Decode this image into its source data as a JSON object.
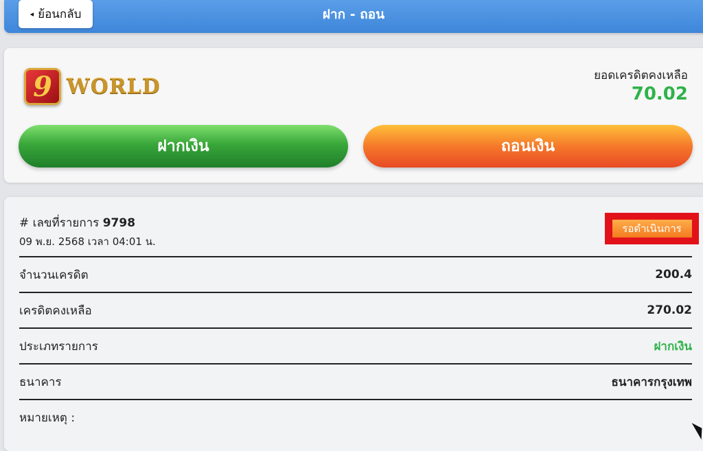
{
  "header": {
    "back_label": "ย้อนกลับ",
    "title": "ฝาก - ถอน"
  },
  "wallet": {
    "logo_text": "WORLD",
    "logo_letter": "9",
    "balance_label": "ยอดเครดิตคงเหลือ",
    "balance_value": "70.02",
    "deposit_label": "ฝากเงิน",
    "withdraw_label": "ถอนเงิน"
  },
  "transaction": {
    "id_prefix": "# เลขที่รายการ",
    "id_number": "9798",
    "datetime": "09 พ.ย. 2568 เวลา 04:01 น.",
    "status": "รอดำเนินการ",
    "rows": [
      {
        "label": "จำนวนเครดิต",
        "value": "200.4"
      },
      {
        "label": "เครดิตคงเหลือ",
        "value": "270.02"
      },
      {
        "label": "ประเภทรายการ",
        "value": "ฝากเงิน"
      },
      {
        "label": "ธนาคาร",
        "value": "ธนาคารกรุงเทพ"
      },
      {
        "label": "หมายเหตุ :",
        "value": ""
      }
    ]
  },
  "colors": {
    "header_blue": "#4a90e2",
    "balance_green": "#30b24a",
    "status_orange": "#f47b20",
    "status_highlight_red": "#e2121a"
  }
}
